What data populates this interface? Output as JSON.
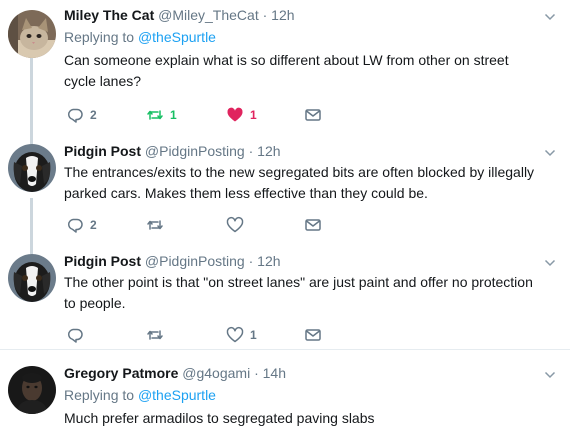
{
  "tweets": [
    {
      "name": "Miley The Cat",
      "handle": "@Miley_TheCat",
      "dot": "·",
      "time": "12h",
      "replying_prefix": "Replying to ",
      "replying_to": "@theSpurtle",
      "text": "Can someone explain what is so different about LW from other on street cycle lanes?",
      "replies": "2",
      "retweets": "1",
      "likes": "1",
      "liked": true,
      "avatar": "cat-avatar"
    },
    {
      "name": "Pidgin Post",
      "handle": "@PidginPosting",
      "dot": "·",
      "time": "12h",
      "text": "The entrances/exits to the new segregated bits are often blocked by illegally parked cars. Makes them less effective than they could be.",
      "replies": "2",
      "retweets": "",
      "likes": "",
      "avatar": "dog-avatar"
    },
    {
      "name": "Pidgin Post",
      "handle": "@PidginPosting",
      "dot": "·",
      "time": "12h",
      "text": "The other point is that \"on street lanes\" are just paint and offer no protection to people.",
      "replies": "",
      "retweets": "",
      "likes": "1",
      "avatar": "dog-avatar"
    },
    {
      "name": "Gregory Patmore",
      "handle": "@g4ogami",
      "dot": "·",
      "time": "14h",
      "replying_prefix": "Replying to ",
      "replying_to": "@theSpurtle",
      "text": "Much prefer armadilos to segregated paving slabs",
      "avatar": "person-avatar"
    }
  ],
  "colors": {
    "retweet_active": "#17bf63",
    "like_active": "#e0245e",
    "link": "#1da1f2",
    "muted": "#657786"
  }
}
